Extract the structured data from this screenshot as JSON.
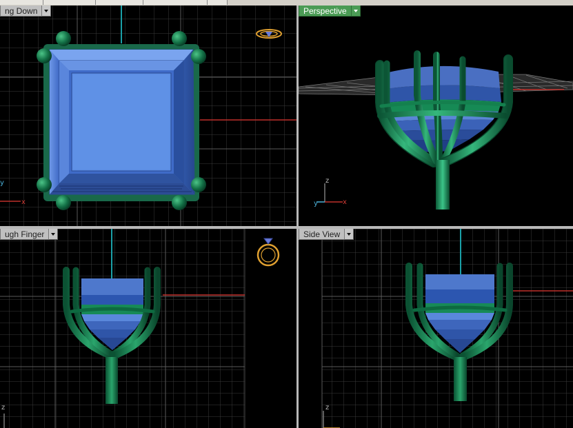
{
  "viewports": {
    "top": {
      "label": "ng Down"
    },
    "perspective": {
      "label": "Perspective"
    },
    "front": {
      "label": "ugh Finger"
    },
    "side": {
      "label": "Side View"
    }
  },
  "axes": {
    "x": "x",
    "y": "y",
    "z": "z"
  },
  "colors": {
    "active_label": "#4b9b55",
    "gem": "#4f7fd8",
    "metal": "#157a4f",
    "grid": "#444444",
    "x_axis": "#c0302a",
    "z_axis": "#1aa0a8"
  }
}
